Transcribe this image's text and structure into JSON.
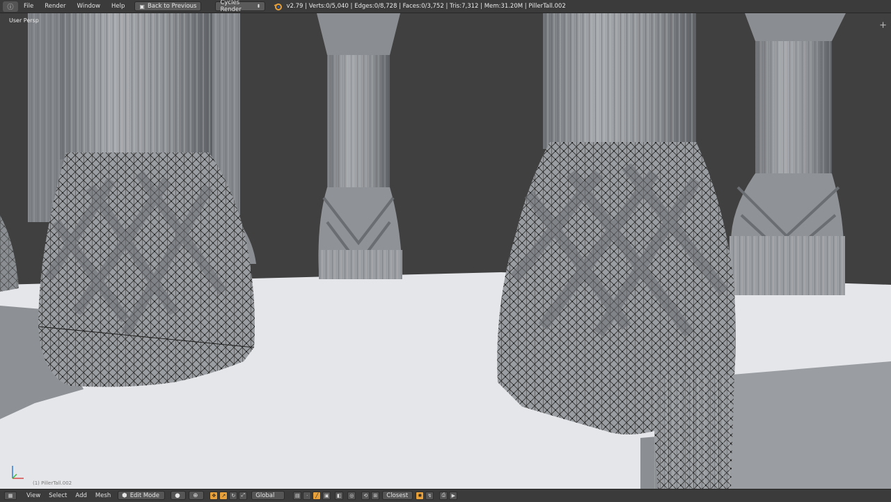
{
  "menu": {
    "items": [
      "File",
      "Render",
      "Window",
      "Help"
    ],
    "back_label": "Back to Previous",
    "render_engine": "Cycles Render"
  },
  "stats": "v2.79 | Verts:0/5,040 | Edges:0/8,728 | Faces:0/3,752 | Tris:7,312 | Mem:31.20M | PillerTall.002",
  "viewport": {
    "view_label": "User Persp",
    "object_label": "(1) PillerTall.002"
  },
  "bottom": {
    "view": "View",
    "select": "Select",
    "add": "Add",
    "mesh": "Mesh",
    "mode": "Edit Mode",
    "orientation": "Global",
    "snap_target": "Closest"
  },
  "colors": {
    "accent": "#e8a13a",
    "background": "#404040",
    "floor": "#e4e6ea",
    "pillar": "#8d9094"
  },
  "icons": {
    "info": "info-icon",
    "back": "back-arrow-icon",
    "blender": "blender-logo-icon",
    "mode": "edit-mode-icon",
    "shading": "solid-shading-icon",
    "pivot": "pivot-icon",
    "axis": "axis-gizmo-icon"
  }
}
